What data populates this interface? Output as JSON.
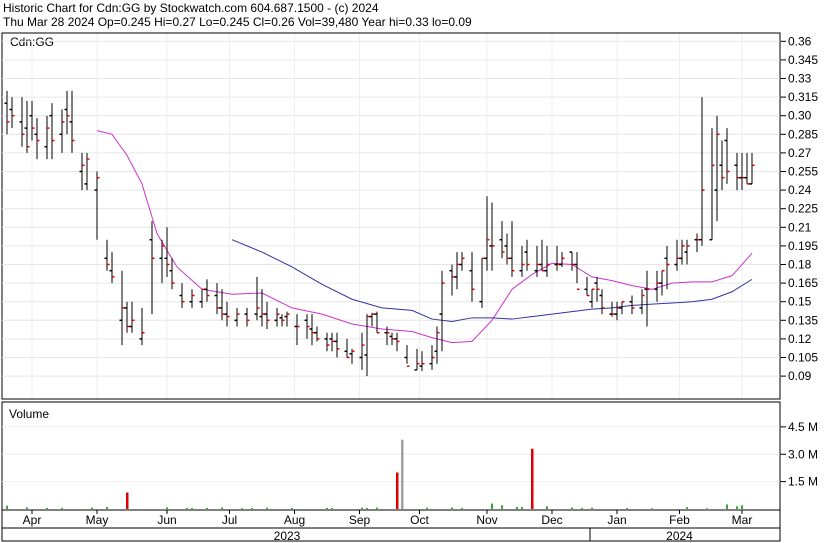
{
  "header": {
    "title": "Historic Chart for Cdn:GG by Stockwatch.com 604.687.1500 - (c) 2024",
    "quote": "Thu Mar 28 2024   Op=0.245   Hi=0.27   Lo=0.245   Cl=0.26   Vol=39,480   Year hi=0.33   lo=0.09"
  },
  "chart_data": [
    {
      "type": "line",
      "title": "Cdn:GG",
      "ylim": [
        0.075,
        0.375
      ],
      "y_ticks": [
        "0.36",
        "0.345",
        "0.33",
        "0.315",
        "0.30",
        "0.285",
        "0.27",
        "0.255",
        "0.24",
        "0.225",
        "0.21",
        "0.195",
        "0.18",
        "0.165",
        "0.15",
        "0.135",
        "0.12",
        "0.105",
        "0.09"
      ],
      "grid": true,
      "series": [
        {
          "style": "ohlc",
          "x": [
            1,
            2,
            4,
            5,
            6,
            7,
            9,
            10,
            12,
            13,
            14,
            16,
            17,
            19,
            21,
            22,
            24,
            25,
            26,
            28,
            30,
            32,
            33,
            34,
            36,
            38,
            40,
            41,
            43,
            44,
            45,
            47,
            49,
            51,
            52,
            53,
            55,
            56,
            57,
            59,
            61,
            62,
            63,
            65,
            66,
            67,
            69,
            70,
            72,
            73,
            74,
            75,
            77,
            78,
            79,
            81,
            83,
            84,
            86,
            87,
            88,
            90,
            91,
            92,
            94,
            96,
            97,
            98,
            100,
            101,
            102,
            104,
            105,
            107,
            108,
            109,
            111,
            112,
            114,
            115,
            117,
            118,
            119,
            120,
            122,
            123,
            124,
            126,
            128,
            129,
            131,
            132,
            133,
            135,
            136,
            137,
            139,
            140,
            142,
            143,
            144,
            145,
            147,
            148,
            149,
            150
          ],
          "open": [
            0.31,
            0.305,
            0.295,
            0.29,
            0.3,
            0.285,
            0.275,
            0.3,
            0.285,
            0.305,
            0.295,
            0.255,
            0.245,
            0.24,
            0.185,
            0.175,
            0.135,
            0.145,
            0.13,
            0.12,
            0.2,
            0.185,
            0.185,
            0.175,
            0.155,
            0.15,
            0.15,
            0.16,
            0.155,
            0.145,
            0.14,
            0.135,
            0.14,
            0.14,
            0.138,
            0.14,
            0.135,
            0.137,
            0.138,
            0.13,
            0.135,
            0.128,
            0.125,
            0.12,
            0.12,
            0.118,
            0.11,
            0.108,
            0.105,
            0.107,
            0.138,
            0.14,
            0.125,
            0.122,
            0.12,
            0.105,
            0.095,
            0.098,
            0.1,
            0.11,
            0.14,
            0.175,
            0.17,
            0.18,
            0.175,
            0.15,
            0.185,
            0.195,
            0.2,
            0.195,
            0.185,
            0.175,
            0.19,
            0.175,
            0.18,
            0.175,
            0.18,
            0.18,
            0.19,
            0.18,
            0.16,
            0.15,
            0.165,
            0.155,
            0.14,
            0.14,
            0.145,
            0.15,
            0.145,
            0.16,
            0.16,
            0.165,
            0.185,
            0.18,
            0.185,
            0.19,
            0.2,
            0.2,
            0.2,
            0.24,
            0.26,
            0.28,
            0.26,
            0.25,
            0.25,
            0.245
          ],
          "high": [
            0.32,
            0.315,
            0.315,
            0.312,
            0.312,
            0.298,
            0.3,
            0.31,
            0.305,
            0.32,
            0.32,
            0.27,
            0.27,
            0.255,
            0.2,
            0.19,
            0.175,
            0.15,
            0.15,
            0.145,
            0.215,
            0.2,
            0.21,
            0.185,
            0.165,
            0.16,
            0.16,
            0.168,
            0.165,
            0.16,
            0.15,
            0.145,
            0.145,
            0.17,
            0.16,
            0.15,
            0.145,
            0.14,
            0.142,
            0.14,
            0.14,
            0.14,
            0.13,
            0.125,
            0.125,
            0.125,
            0.12,
            0.112,
            0.125,
            0.14,
            0.141,
            0.142,
            0.13,
            0.125,
            0.125,
            0.115,
            0.112,
            0.11,
            0.115,
            0.13,
            0.175,
            0.18,
            0.19,
            0.19,
            0.19,
            0.185,
            0.235,
            0.23,
            0.215,
            0.205,
            0.215,
            0.195,
            0.2,
            0.195,
            0.2,
            0.195,
            0.195,
            0.19,
            0.19,
            0.19,
            0.17,
            0.16,
            0.17,
            0.16,
            0.15,
            0.15,
            0.15,
            0.155,
            0.16,
            0.175,
            0.175,
            0.175,
            0.195,
            0.2,
            0.2,
            0.2,
            0.205,
            0.315,
            0.29,
            0.3,
            0.28,
            0.29,
            0.27,
            0.27,
            0.27,
            0.27
          ],
          "low": [
            0.285,
            0.29,
            0.275,
            0.27,
            0.28,
            0.265,
            0.265,
            0.265,
            0.27,
            0.285,
            0.27,
            0.24,
            0.24,
            0.2,
            0.175,
            0.165,
            0.115,
            0.125,
            0.125,
            0.115,
            0.14,
            0.165,
            0.17,
            0.16,
            0.145,
            0.145,
            0.145,
            0.15,
            0.14,
            0.135,
            0.13,
            0.13,
            0.13,
            0.135,
            0.13,
            0.128,
            0.13,
            0.13,
            0.13,
            0.115,
            0.12,
            0.115,
            0.118,
            0.11,
            0.11,
            0.105,
            0.105,
            0.1,
            0.095,
            0.09,
            0.13,
            0.125,
            0.115,
            0.115,
            0.11,
            0.1,
            0.095,
            0.094,
            0.095,
            0.1,
            0.11,
            0.155,
            0.16,
            0.175,
            0.15,
            0.145,
            0.175,
            0.175,
            0.185,
            0.18,
            0.17,
            0.17,
            0.175,
            0.17,
            0.175,
            0.17,
            0.175,
            0.178,
            0.175,
            0.165,
            0.155,
            0.145,
            0.15,
            0.14,
            0.138,
            0.135,
            0.14,
            0.14,
            0.14,
            0.13,
            0.15,
            0.155,
            0.16,
            0.175,
            0.18,
            0.18,
            0.19,
            0.195,
            0.2,
            0.215,
            0.24,
            0.245,
            0.24,
            0.24,
            0.245,
            0.245
          ],
          "close": [
            0.295,
            0.3,
            0.285,
            0.275,
            0.29,
            0.28,
            0.29,
            0.28,
            0.295,
            0.3,
            0.28,
            0.26,
            0.265,
            0.25,
            0.18,
            0.17,
            0.145,
            0.13,
            0.135,
            0.125,
            0.185,
            0.195,
            0.18,
            0.165,
            0.15,
            0.155,
            0.16,
            0.155,
            0.145,
            0.14,
            0.138,
            0.14,
            0.135,
            0.145,
            0.14,
            0.135,
            0.14,
            0.135,
            0.14,
            0.13,
            0.13,
            0.125,
            0.12,
            0.115,
            0.118,
            0.112,
            0.105,
            0.11,
            0.115,
            0.138,
            0.14,
            0.125,
            0.125,
            0.12,
            0.118,
            0.098,
            0.1,
            0.1,
            0.105,
            0.125,
            0.165,
            0.17,
            0.18,
            0.185,
            0.16,
            0.185,
            0.2,
            0.195,
            0.19,
            0.185,
            0.175,
            0.18,
            0.18,
            0.18,
            0.175,
            0.18,
            0.18,
            0.185,
            0.18,
            0.16,
            0.155,
            0.16,
            0.16,
            0.145,
            0.14,
            0.145,
            0.15,
            0.145,
            0.155,
            0.16,
            0.165,
            0.175,
            0.18,
            0.185,
            0.195,
            0.195,
            0.2,
            0.24,
            0.26,
            0.285,
            0.25,
            0.255,
            0.25,
            0.25,
            0.245,
            0.26
          ]
        },
        {
          "style": "moving-average",
          "color": "#cc33cc",
          "x": [
            19,
            22,
            25,
            28,
            31,
            35,
            40,
            46,
            52,
            58,
            64,
            70,
            76,
            82,
            86,
            90,
            94,
            98,
            102,
            106,
            110,
            114,
            118,
            122,
            126,
            130,
            134,
            138,
            142,
            146,
            150
          ],
          "y": [
            0.288,
            0.285,
            0.268,
            0.245,
            0.205,
            0.178,
            0.16,
            0.156,
            0.157,
            0.145,
            0.14,
            0.132,
            0.128,
            0.126,
            0.121,
            0.117,
            0.118,
            0.135,
            0.16,
            0.172,
            0.181,
            0.18,
            0.17,
            0.167,
            0.163,
            0.16,
            0.165,
            0.166,
            0.166,
            0.171,
            0.189
          ]
        },
        {
          "style": "moving-average",
          "color": "#33339f",
          "x": [
            46,
            52,
            58,
            64,
            70,
            76,
            82,
            86,
            90,
            94,
            98,
            102,
            106,
            110,
            114,
            118,
            122,
            126,
            130,
            134,
            138,
            142,
            146,
            150
          ],
          "y": [
            0.2,
            0.19,
            0.178,
            0.164,
            0.152,
            0.145,
            0.143,
            0.136,
            0.134,
            0.137,
            0.137,
            0.136,
            0.138,
            0.14,
            0.142,
            0.144,
            0.145,
            0.147,
            0.148,
            0.149,
            0.15,
            0.152,
            0.158,
            0.168
          ]
        }
      ]
    },
    {
      "type": "bar",
      "title": "Volume",
      "ylim": [
        0,
        5200000
      ],
      "y_ticks": [
        "4.5 M",
        "3.0 M",
        "1.5 M"
      ],
      "x": [
        1,
        5,
        9,
        12,
        18,
        21,
        25,
        33,
        37,
        38,
        41,
        44,
        48,
        50,
        53,
        58,
        65,
        66,
        72,
        73,
        75,
        85,
        90,
        92,
        98,
        100,
        103,
        104,
        109,
        114,
        116,
        118,
        125,
        130,
        137,
        141,
        145,
        147,
        148
      ],
      "values": [
        180000,
        90000,
        60000,
        60000,
        70000,
        110000,
        160000,
        90000,
        60000,
        50000,
        60000,
        80000,
        50000,
        60000,
        70000,
        60000,
        60000,
        60000,
        70000,
        60000,
        80000,
        70000,
        80000,
        60000,
        300000,
        200000,
        110000,
        110000,
        150000,
        80000,
        60000,
        70000,
        50000,
        40000,
        100000,
        40000,
        250000,
        150000,
        200000
      ],
      "highlight": [
        {
          "x": 25,
          "value": 900000,
          "color": "#dd0000"
        },
        {
          "x": 79,
          "value": 2000000,
          "color": "#dd0000"
        },
        {
          "x": 80,
          "value": 3800000,
          "color": "#a0a0a0"
        },
        {
          "x": 106,
          "value": 3300000,
          "color": "#dd0000"
        }
      ],
      "x_month_labels": [
        {
          "x": -4.5,
          "label": "ar"
        },
        {
          "x": 6,
          "label": "Apr"
        },
        {
          "x": 19,
          "label": "May"
        },
        {
          "x": 33,
          "label": "Jun"
        },
        {
          "x": 45.5,
          "label": "Jul"
        },
        {
          "x": 58.5,
          "label": "Aug"
        },
        {
          "x": 71.5,
          "label": "Sep"
        },
        {
          "x": 83.5,
          "label": "Oct"
        },
        {
          "x": 97,
          "label": "Nov"
        },
        {
          "x": 110,
          "label": "Dec"
        },
        {
          "x": 123,
          "label": "Jan"
        },
        {
          "x": 135.5,
          "label": "Feb"
        },
        {
          "x": 148,
          "label": "Mar"
        }
      ],
      "x_year_labels": [
        {
          "x": 57,
          "label": "2023"
        },
        {
          "x": 135.5,
          "label": "2024"
        }
      ]
    }
  ]
}
